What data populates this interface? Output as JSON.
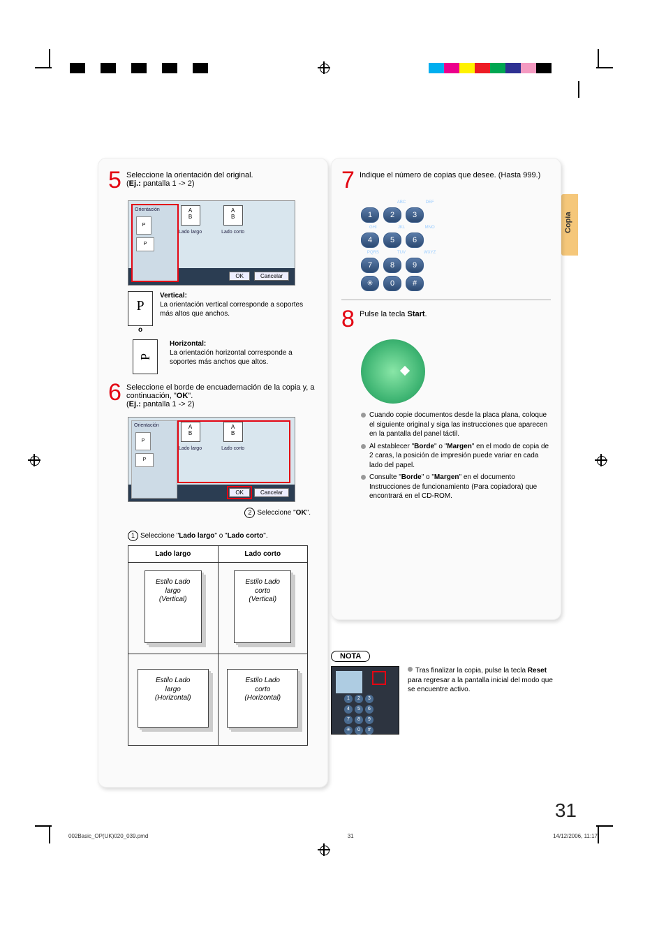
{
  "side_tab": "Copia",
  "page_number": "31",
  "step5": {
    "num": "5",
    "line1": "Seleccione la orientación del original.",
    "ej_label": "Ej.:",
    "ej_val": " pantalla 1 -> 2)",
    "shot": {
      "title": "Orientación",
      "p": "P",
      "lado_largo": "Lado largo",
      "lado_corto": "Lado corto",
      "ab": "A\nB",
      "ok": "OK",
      "cancel": "Cancelar"
    },
    "vert_title": "Vertical:",
    "vert_body": "La orientación vertical corresponde a soportes más altos que anchos.",
    "o_sep": "o",
    "horiz_title": "Horizontal:",
    "horiz_body": "La orientación horizontal corresponde a soportes más anchos que altos."
  },
  "step6": {
    "num": "6",
    "line1a": "Seleccione el borde de encuadernación de la copia y, a continuación, \"",
    "line1b": "OK",
    "line1c": "\".",
    "ej_label": "Ej.:",
    "ej_val": " pantalla 1 -> 2)",
    "cap2a": "Seleccione \"",
    "cap2b": "OK",
    "cap2c": "\".",
    "cap1a": "Seleccione \"",
    "cap1b": "Lado largo",
    "cap1c": "\" o \"",
    "cap1d": "Lado corto",
    "cap1e": "\"."
  },
  "bind_table": {
    "h1": "Lado largo",
    "h2": "Lado corto",
    "c1": "Estilo Lado\nlargo\n(Vertical)",
    "c2": "Estilo Lado\ncorto\n(Vertical)",
    "c3": "Estilo Lado\nlargo\n(Horizontal)",
    "c4": "Estilo Lado\ncorto\n(Horizontal)"
  },
  "step7": {
    "num": "7",
    "line1": "Indique el número de copias que desee. (Hasta 999.)",
    "keypad": {
      "t1": "ABC",
      "t2": "DEF",
      "t3": "GHI",
      "t4": "JKL",
      "t5": "MNO",
      "t6": "PQRS",
      "t7": "TUV",
      "t8": "WXYZ",
      "k1": "1",
      "k2": "2",
      "k3": "3",
      "k4": "4",
      "k5": "5",
      "k6": "6",
      "k7": "7",
      "k8": "8",
      "k9": "9",
      "ks": "✳",
      "k0": "0",
      "kh": "#"
    }
  },
  "step8": {
    "num": "8",
    "line_a": "Pulse la tecla ",
    "line_b": "Start",
    "line_c": ".",
    "bul1": "Cuando copie documentos desde la placa plana, coloque el siguiente original y siga las instrucciones que aparecen en la pantalla del panel táctil.",
    "bul2a": "Al establecer \"",
    "bul2b": "Borde",
    "bul2c": "\" o \"",
    "bul2d": "Margen",
    "bul2e": "\" en el modo de copia de 2 caras, la posición de impresión puede variar en cada lado del papel.",
    "bul3a": "Consulte \"",
    "bul3b": "Borde",
    "bul3c": "\" o \"",
    "bul3d": "Margen",
    "bul3e": "\" en el documento Instrucciones de funcionamiento (Para copiadora) que encontrará en el CD-ROM."
  },
  "nota": {
    "label": "NOTA",
    "text_a": "Tras finalizar la copia, pulse la tecla ",
    "text_b": "Reset",
    "text_c": " para regresar a la pantalla inicial del modo que se encuentre activo.",
    "mini_kpad": {
      "k1": "1",
      "k2": "2",
      "k3": "3",
      "k4": "4",
      "k5": "5",
      "k6": "6",
      "k7": "7",
      "k8": "8",
      "k9": "9",
      "ks": "✳",
      "k0": "0",
      "kh": "#"
    }
  },
  "footer": {
    "file": "002Basic_OP(UK)020_039.pmd",
    "pg": "31",
    "date": "14/12/2006, 11:17"
  }
}
